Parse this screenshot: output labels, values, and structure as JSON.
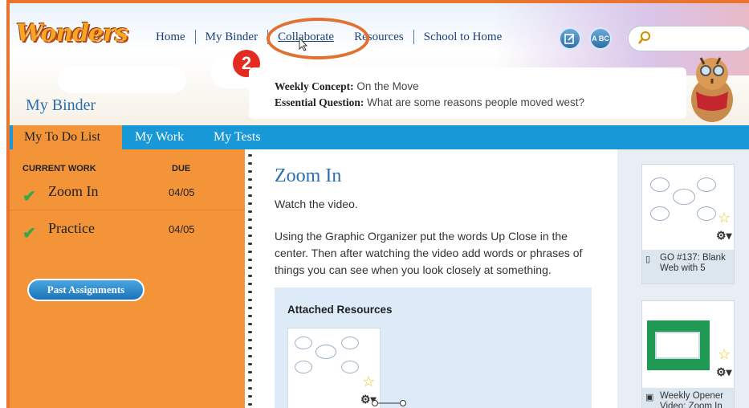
{
  "brand": {
    "logo_text": "Wonders"
  },
  "nav": {
    "items": [
      {
        "label": "Home"
      },
      {
        "label": "My Binder"
      },
      {
        "label": "Collaborate"
      },
      {
        "label": "Resources"
      },
      {
        "label": "School to Home"
      }
    ],
    "abc_icon_text": "A BC"
  },
  "annotation": {
    "step_number": "2"
  },
  "binder": {
    "title": "My Binder",
    "concept_label": "Weekly Concept:",
    "concept_value": "On the Move",
    "question_label": "Essential Question:",
    "question_value": "What are some reasons people moved west?"
  },
  "tabs": [
    {
      "label": "My To Do List"
    },
    {
      "label": "My Work"
    },
    {
      "label": "My Tests"
    }
  ],
  "todo": {
    "header_current": "CURRENT WORK",
    "header_due": "DUE",
    "tasks": [
      {
        "name": "Zoom In",
        "due": "04/05"
      },
      {
        "name": "Practice",
        "due": "04/05"
      }
    ],
    "past_button": "Past Assignments"
  },
  "lesson": {
    "title": "Zoom In",
    "line1": "Watch the video.",
    "line2": "Using the Graphic Organizer put the words Up Close in the center. Then after watching the video add words or phrases of things you can see when you look closely at something.",
    "attached_title": "Attached Resources"
  },
  "resources": [
    {
      "caption": "GO #137: Blank Web with 5"
    },
    {
      "caption": "Weekly Opener Video: Zoom In"
    }
  ],
  "colors": {
    "orange": "#f39438",
    "tab_blue": "#1898d6",
    "title_blue": "#2a6fb0",
    "annotation_orange": "#e27131",
    "badge_red": "#e32b22"
  }
}
